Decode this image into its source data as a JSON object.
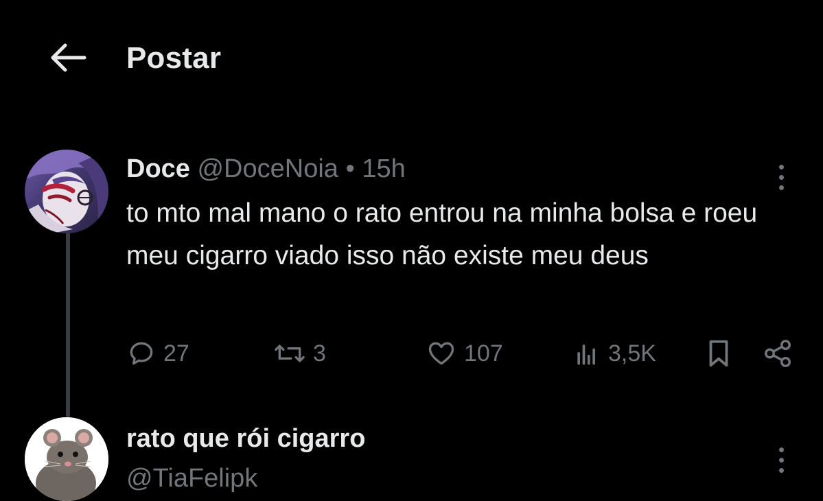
{
  "header": {
    "title": "Postar",
    "back_icon": "arrow-left-icon"
  },
  "post": {
    "author_name": "Doce",
    "handle": "@DoceNoia",
    "separator": "•",
    "time": "15h",
    "text": "to mto mal mano o rato entrou na minha bolsa e roeu meu cigarro viado isso não existe meu deus",
    "actions": {
      "replies": "27",
      "reposts": "3",
      "likes": "107",
      "views": "3,5K"
    }
  },
  "reply": {
    "author_name": "rato que rói cigarro",
    "handle": "@TiaFelipk"
  },
  "colors": {
    "background": "#000000",
    "primary_text": "#e7e9ea",
    "secondary_text": "#71767b",
    "thread_line": "#3a3d40"
  }
}
